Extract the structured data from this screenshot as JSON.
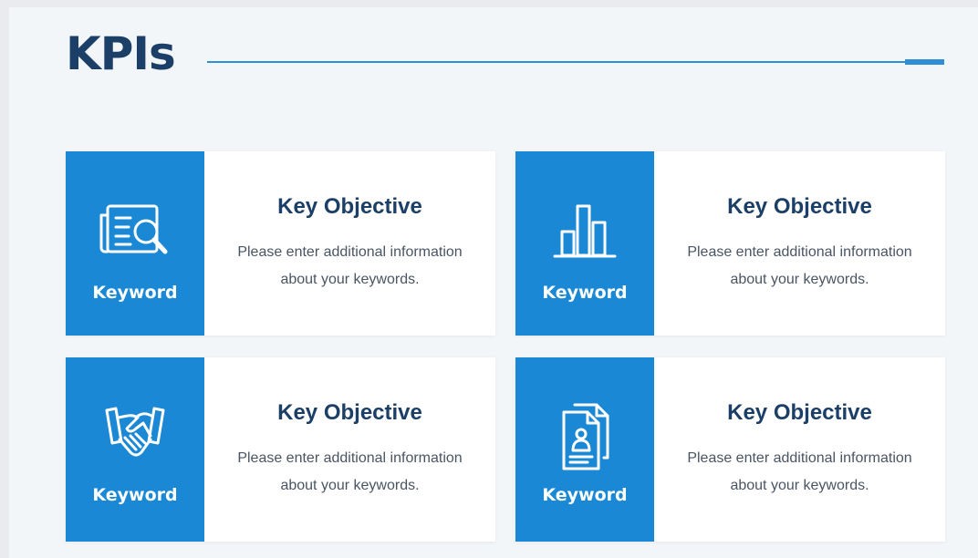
{
  "title": "KPIs",
  "colors": {
    "accent": "#1a88d4",
    "heading": "#1b3f66",
    "background": "#f3f6f9",
    "card": "#ffffff"
  },
  "cards": [
    {
      "icon": "document-search-icon",
      "badge_label": "Keyword",
      "heading": "Key Objective",
      "description": "Please enter additional information about your keywords."
    },
    {
      "icon": "bar-chart-icon",
      "badge_label": "Keyword",
      "heading": "Key Objective",
      "description": "Please enter additional information about your keywords."
    },
    {
      "icon": "handshake-icon",
      "badge_label": "Keyword",
      "heading": "Key Objective",
      "description": "Please enter additional information about your keywords."
    },
    {
      "icon": "profile-document-icon",
      "badge_label": "Keyword",
      "heading": "Key Objective",
      "description": "Please enter additional information about your keywords."
    }
  ]
}
